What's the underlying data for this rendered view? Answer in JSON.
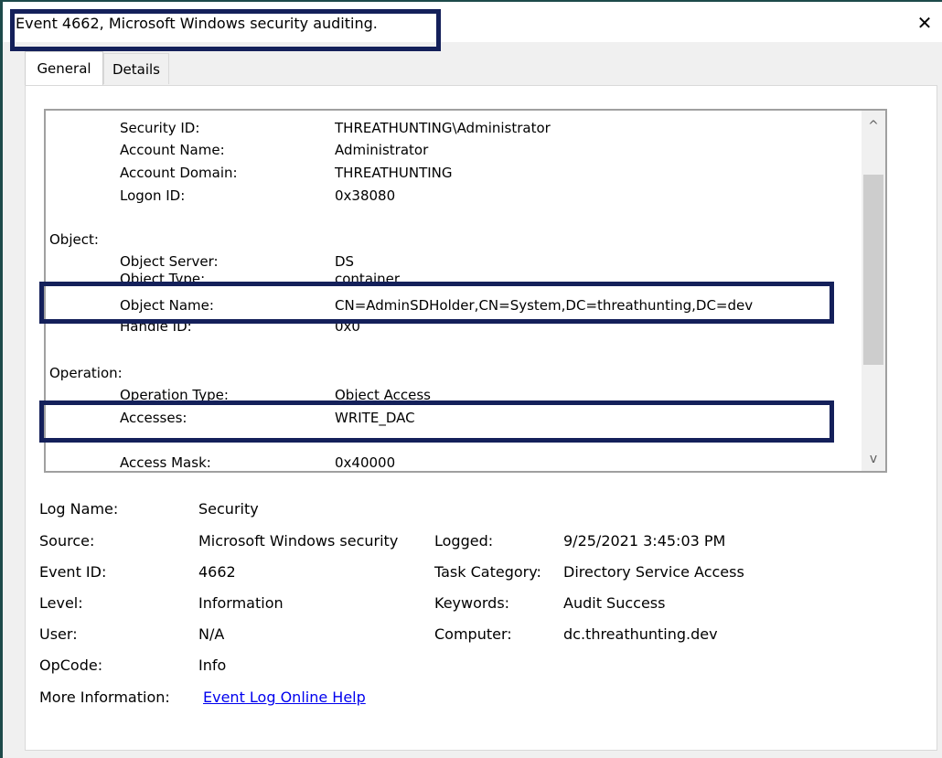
{
  "window": {
    "title": "Event 4662, Microsoft Windows security auditing.",
    "close_icon": "✕"
  },
  "tabs": [
    {
      "label": "General",
      "active": true
    },
    {
      "label": "Details",
      "active": false
    }
  ],
  "description": {
    "subject_fields": [
      {
        "label": "Security ID:",
        "value": "THREATHUNTING\\Administrator"
      },
      {
        "label": "Account Name:",
        "value": "Administrator"
      },
      {
        "label": "Account Domain:",
        "value": "THREATHUNTING"
      },
      {
        "label": "Logon ID:",
        "value": "0x38080"
      }
    ],
    "object_header": "Object:",
    "object_fields": [
      {
        "label": "Object Server:",
        "value": "DS"
      },
      {
        "label": "Object Type:",
        "value": "container"
      },
      {
        "label": "Object Name:",
        "value": "CN=AdminSDHolder,CN=System,DC=threathunting,DC=dev"
      },
      {
        "label": "Handle ID:",
        "value": "0x0"
      }
    ],
    "operation_header": "Operation:",
    "operation_fields": [
      {
        "label": "Operation Type:",
        "value": "Object Access"
      },
      {
        "label": "Accesses:",
        "value": "WRITE_DAC"
      },
      {
        "label": "Access Mask:",
        "value": "0x40000"
      }
    ],
    "scroll_up_icon": "^",
    "scroll_down_icon": "v"
  },
  "properties": {
    "log_name": {
      "label": "Log Name:",
      "value": "Security"
    },
    "source": {
      "label": "Source:",
      "value": "Microsoft Windows security"
    },
    "logged": {
      "label": "Logged:",
      "value": "9/25/2021 3:45:03 PM"
    },
    "event_id": {
      "label": "Event ID:",
      "value": "4662"
    },
    "task_category": {
      "label": "Task Category:",
      "value": "Directory Service Access"
    },
    "level": {
      "label": "Level:",
      "value": "Information"
    },
    "keywords": {
      "label": "Keywords:",
      "value": "Audit Success"
    },
    "user": {
      "label": "User:",
      "value": "N/A"
    },
    "computer": {
      "label": "Computer:",
      "value": "dc.threathunting.dev"
    },
    "opcode": {
      "label": "OpCode:",
      "value": "Info"
    },
    "more_info": {
      "label": "More Information:",
      "link": "Event Log Online Help"
    }
  },
  "colors": {
    "highlight_border": "#14205a",
    "link": "#0000ee",
    "window_frame": "#1d4a4a"
  }
}
